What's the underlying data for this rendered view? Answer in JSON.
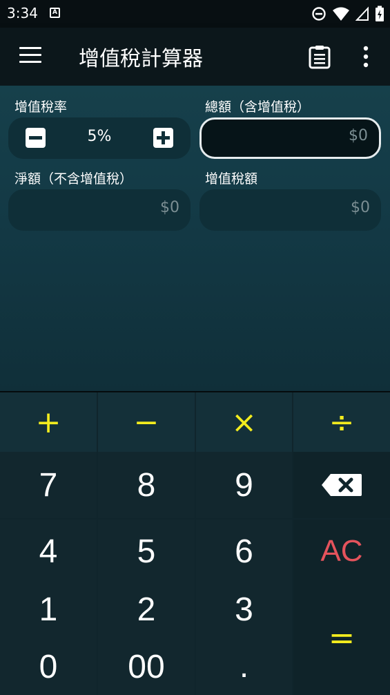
{
  "status_bar": {
    "time": "3:34",
    "notification_icon": "A"
  },
  "app_bar": {
    "title": "增值稅計算器"
  },
  "form": {
    "rate_label": "增值稅率",
    "rate_value": "5%",
    "gross_label": "總額（含增值稅）",
    "gross_value": "$0",
    "net_label": "淨額（不含增值稅）",
    "net_value": "$0",
    "vat_label": "增值稅額",
    "vat_value": "$0"
  },
  "keypad": {
    "plus": "+",
    "minus": "−",
    "multiply": "×",
    "divide": "÷",
    "k7": "7",
    "k8": "8",
    "k9": "9",
    "k4": "4",
    "k5": "5",
    "k6": "6",
    "k1": "1",
    "k2": "2",
    "k3": "3",
    "k0": "0",
    "k00": "00",
    "dot": ".",
    "clear": "AC",
    "equals": "="
  },
  "colors": {
    "accent_yellow": "#f3ec1e",
    "clear_red": "#e4535c",
    "form_bg": "#16404b"
  }
}
